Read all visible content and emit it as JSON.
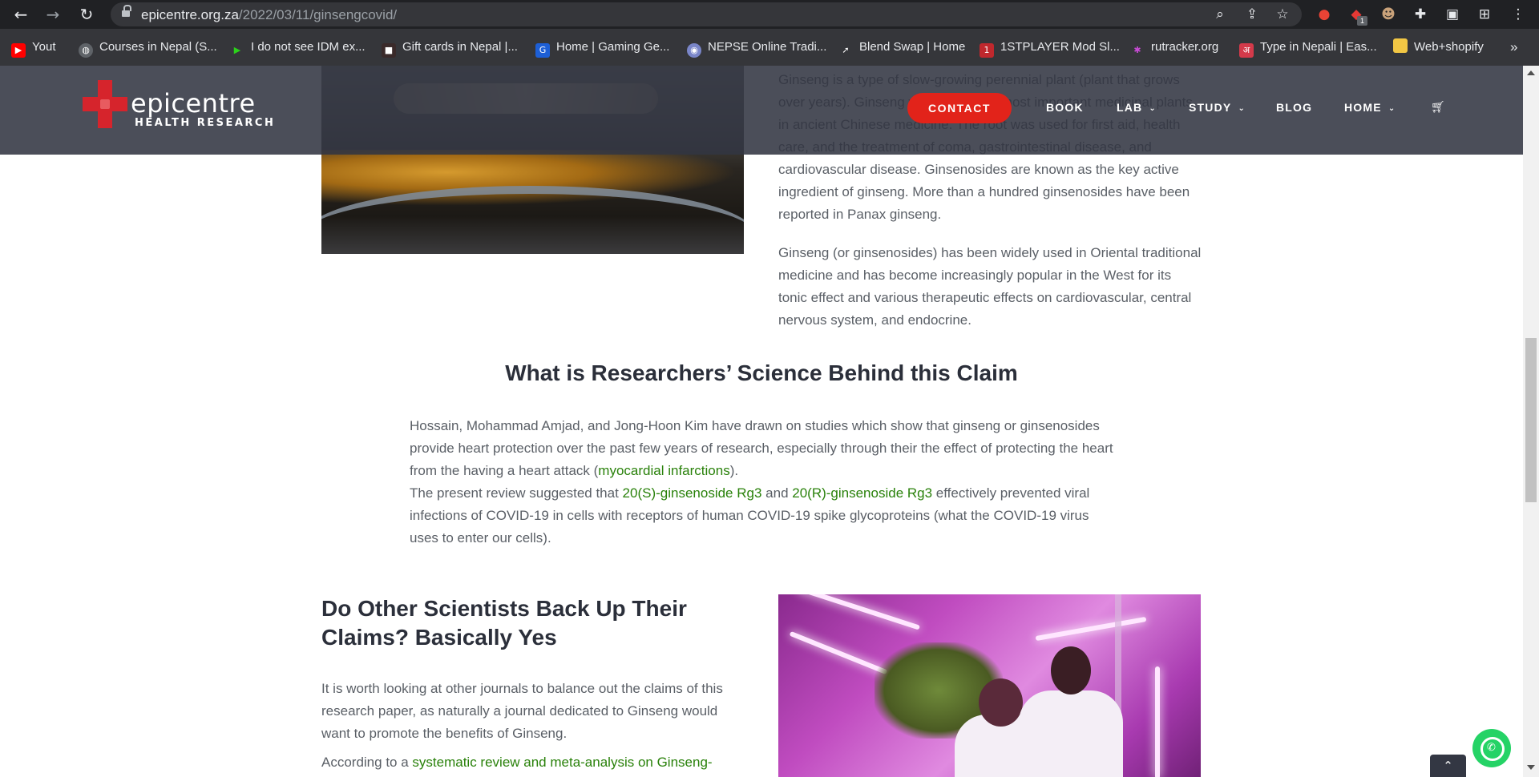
{
  "browser": {
    "url_domain": "epicentre.org.za",
    "url_path": "/2022/03/11/ginsengcovid/",
    "icons": [
      "back-icon",
      "forward-icon",
      "reload-icon",
      "lock-icon",
      "zoom-icon",
      "share-icon",
      "star-icon",
      "extensions-icon",
      "sidepanel-icon",
      "menu-icon"
    ],
    "extension_badge": "1",
    "bookmarks": [
      {
        "label": "Yout",
        "color": "#ff0000"
      },
      {
        "label": "Courses in Nepal (S...",
        "color": "#5f6368"
      },
      {
        "label": "I do not see IDM ex...",
        "color": "#2bd21a"
      },
      {
        "label": "Gift cards in Nepal |...",
        "color": "#3a2a2a"
      },
      {
        "label": "Home | Gaming Ge...",
        "color": "#1d5fd6"
      },
      {
        "label": "NEPSE Online Tradi...",
        "color": "#7a86c9"
      },
      {
        "label": "Blend Swap | Home",
        "color": "#35363a"
      },
      {
        "label": "1STPLAYER Mod Sl...",
        "color": "#c0282d"
      },
      {
        "label": "rutracker.org",
        "color": "#6e3fb7"
      },
      {
        "label": "Type in Nepali | Eas...",
        "color": "#d43a4a"
      },
      {
        "label": "Web+shopify",
        "color": "#f2c744"
      }
    ],
    "more_bookmarks": "»"
  },
  "site": {
    "logo_main": "epicentre",
    "logo_sub": "HEALTH RESEARCH",
    "contact_label": "CONTACT",
    "nav": [
      {
        "label": "BOOK",
        "dropdown": false
      },
      {
        "label": "LAB",
        "dropdown": true
      },
      {
        "label": "STUDY",
        "dropdown": true
      },
      {
        "label": "BLOG",
        "dropdown": false
      },
      {
        "label": "HOME",
        "dropdown": true
      }
    ],
    "accent_color": "#e2231a",
    "link_color": "#29810a"
  },
  "article": {
    "intro_text": "Ginseng is a type of slow-growing perennial plant (plant that grows over years). Ginseng was one of the most important medicinal plants in ancient Chinese medicine. The root was used for first aid, health care, and the treatment of coma, gastrointestinal disease, and cardiovascular disease. Ginsenosides are known as the key active ingredient of ginseng. More than a hundred ginsenosides have been reported in Panax ginseng.",
    "intro_p2": "Ginseng (or ginsenosides) has been widely used in Oriental traditional medicine and has become increasingly popular in the West for its tonic effect and various therapeutic effects on cardiovascular, central nervous system, and endocrine.",
    "heading1": "What is Researchers’ Science Behind this Claim",
    "p1_before": "Hossain, Mohammad Amjad, and Jong-Hoon Kim have drawn on studies which show that ginseng or ginsenosides provide heart protection over the past few years of research, especially through their the effect of protecting the heart from the having a heart attack (",
    "p1_link": "myocardial infarctions",
    "p1_after": ").",
    "p2_before": "The present review suggested that ",
    "p2_link1": "20(S)-ginsenoside Rg3",
    "p2_mid": " and ",
    "p2_link2": "20(R)-ginsenoside Rg3",
    "p2_after": " effectively prevented viral infections of COVID-19 in cells with receptors of human COVID-19 spike glycoproteins (what the COVID-19 virus uses to enter our cells).",
    "heading2": "Do Other Scientists Back Up Their Claims? Basically Yes",
    "p3": "It is worth looking at other journals to balance out the claims of this research paper, as naturally a journal dedicated to Ginseng would want to promote the benefits of Ginseng.",
    "p4_before": "According to a ",
    "p4_link": "systematic review and meta-analysis on Ginseng-"
  },
  "widgets": {
    "totop_icon": "chevron-up-icon",
    "whatsapp_icon": "whatsapp-icon"
  }
}
